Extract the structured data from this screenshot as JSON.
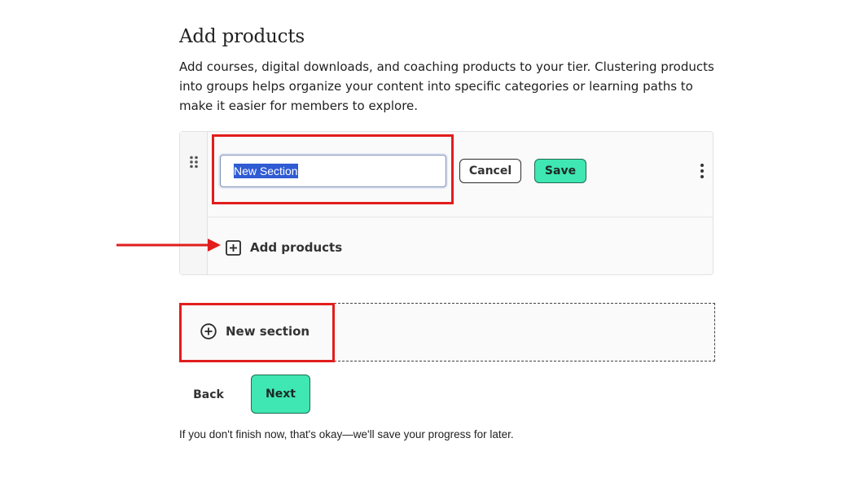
{
  "header": {
    "title": "Add products",
    "description": "Add courses, digital downloads, and coaching products to your tier. Clustering products into groups helps organize your content into specific categories or learning paths to make it easier for members to explore."
  },
  "section_editor": {
    "name_input_value": "New Section",
    "cancel_label": "Cancel",
    "save_label": "Save",
    "add_products_label": "Add products"
  },
  "new_section": {
    "label": "New section"
  },
  "footer": {
    "back_label": "Back",
    "next_label": "Next",
    "note": "If you don't finish now, that's okay—we'll save your progress for later."
  },
  "colors": {
    "accent": "#3fe7b2",
    "annotation_red": "#e21d1d",
    "selection": "#2f5bd3"
  },
  "icons": {
    "drag": "drag-handle-icon",
    "more": "kebab-menu-icon",
    "add_products": "plus-square-icon",
    "new_section": "plus-circle-icon"
  }
}
